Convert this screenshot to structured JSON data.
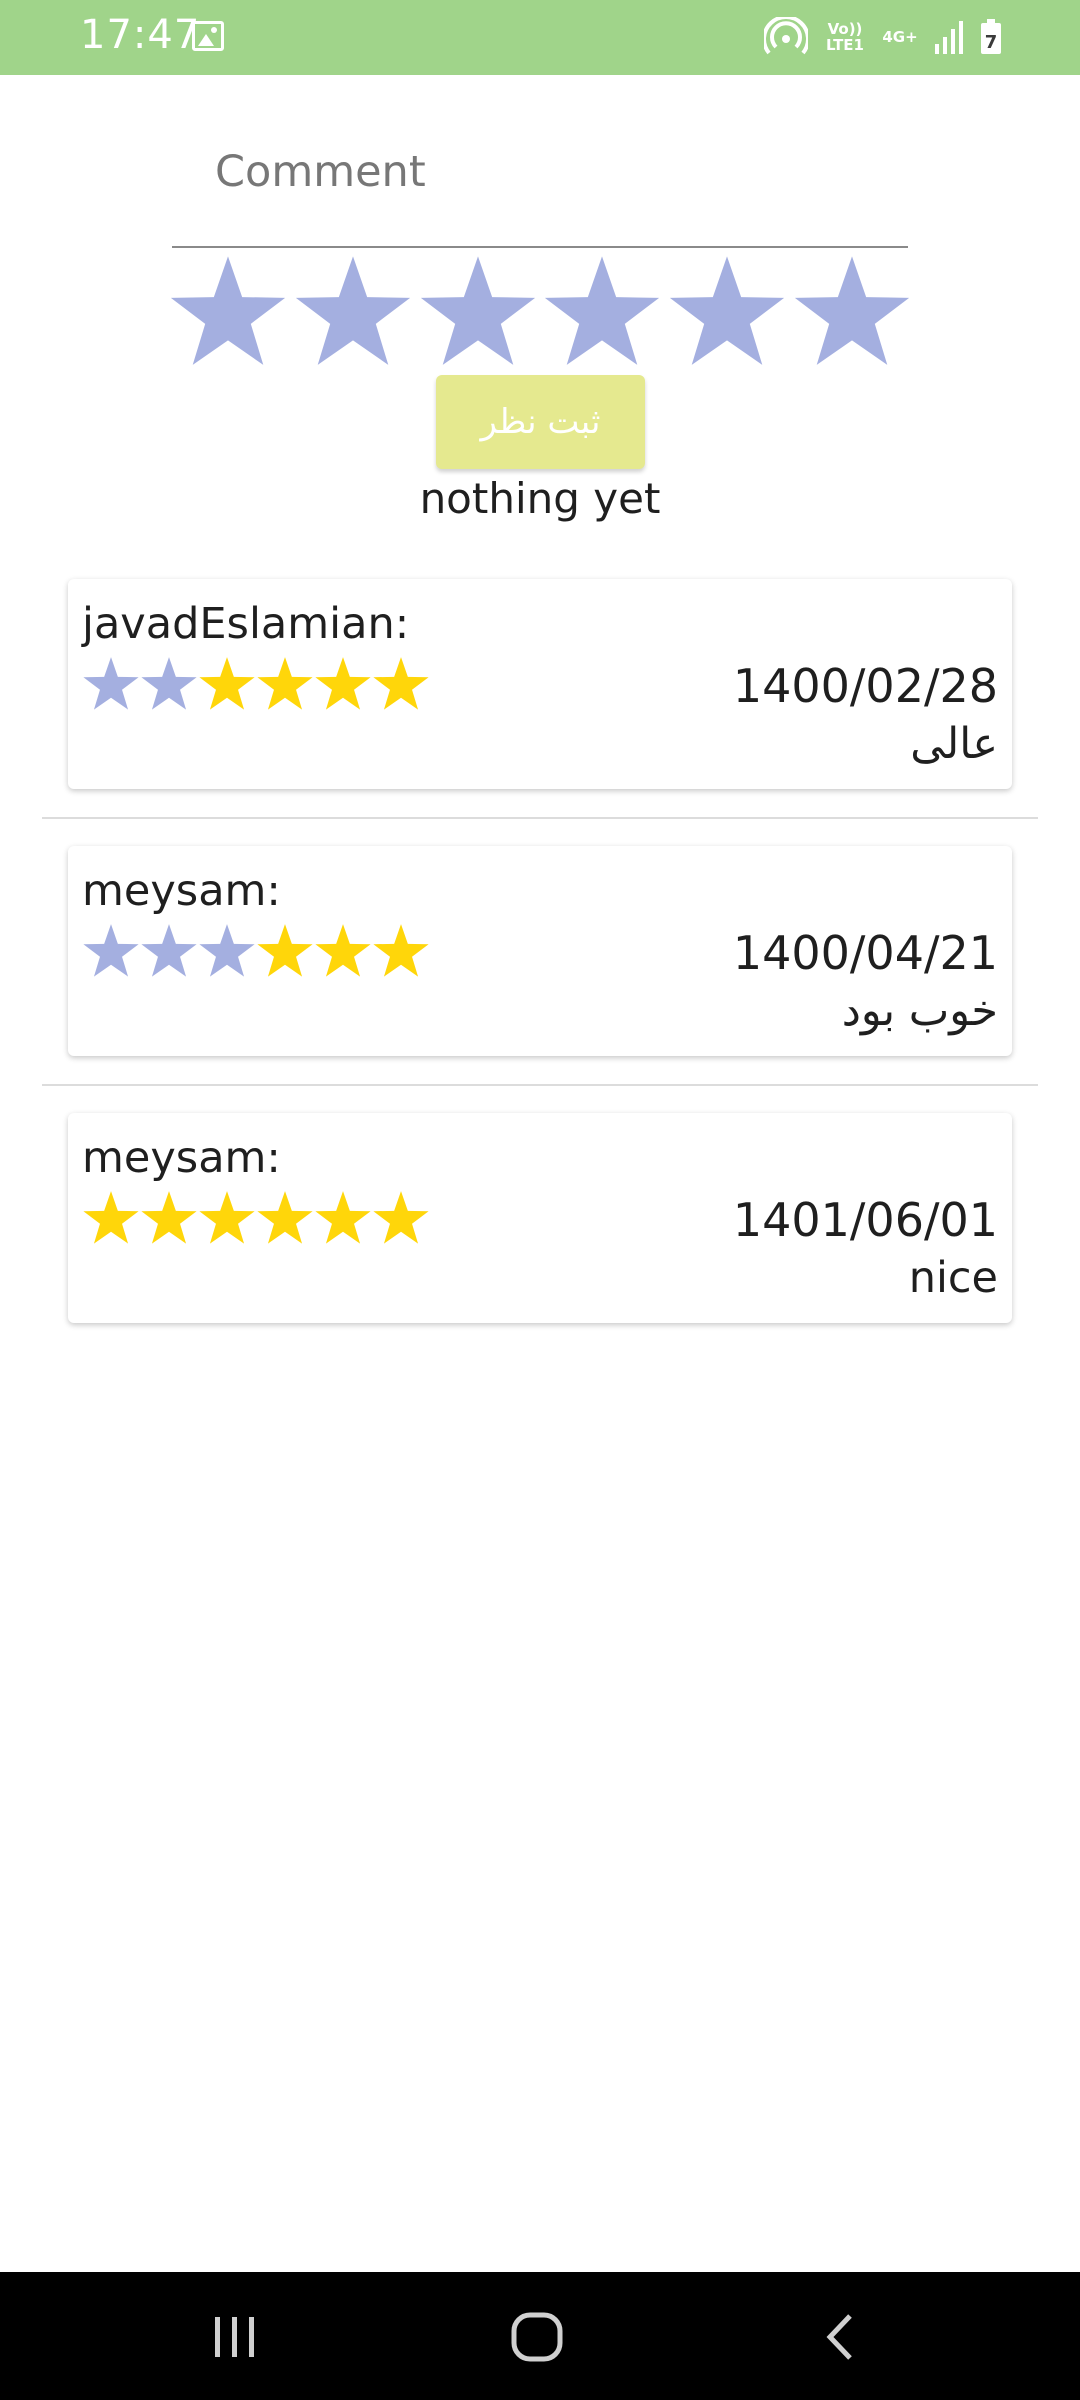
{
  "status_bar": {
    "time": "17:47",
    "volte": "Vo)) LTE1",
    "network": "4G+",
    "battery": "7",
    "icons": [
      "image-icon",
      "hotspot-icon",
      "signal-icon",
      "battery-icon"
    ]
  },
  "form": {
    "comment_placeholder": "Comment",
    "rating_star_count": 6,
    "submit_label": "ثبت نظر",
    "status_text": "nothing yet"
  },
  "colors": {
    "status_bar": "#a0d48a",
    "star_empty": "#a4afe0",
    "star_filled": "#ffd60a",
    "submit_button": "#e5e98f"
  },
  "reviews": [
    {
      "user": "javadEslamian:",
      "rating": 4,
      "date": "1400/02/28",
      "text": "عالی"
    },
    {
      "user": "meysam:",
      "rating": 3,
      "date": "1400/04/21",
      "text": "خوب بود"
    },
    {
      "user": "meysam:",
      "rating": 6,
      "date": "1401/06/01",
      "text": "nice"
    }
  ],
  "nav": {
    "icons": [
      "recent-apps-icon",
      "home-icon",
      "back-icon"
    ]
  }
}
